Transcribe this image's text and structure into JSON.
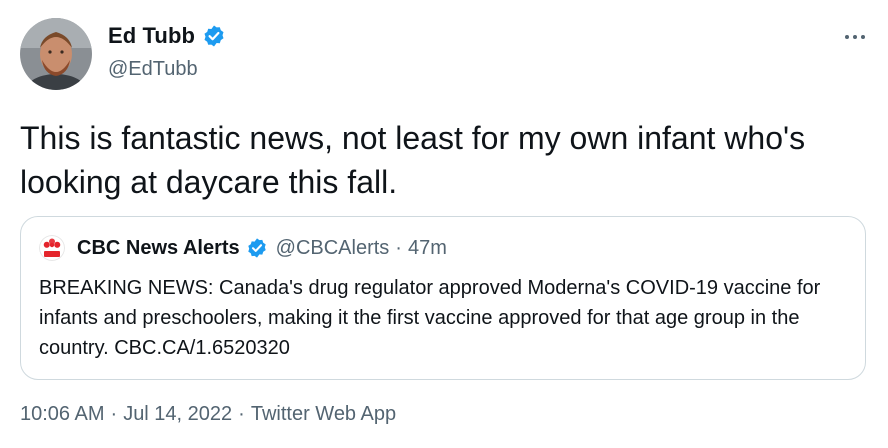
{
  "author": {
    "display_name": "Ed Tubb",
    "handle": "@EdTubb",
    "verified_icon": "verified-badge-icon"
  },
  "tweet": {
    "text": "This is fantastic news, not least for my own infant who's looking at daycare this fall."
  },
  "quoted": {
    "display_name": "CBC News Alerts",
    "handle": "@CBCAlerts",
    "separator": "·",
    "time": "47m",
    "text": "BREAKING NEWS: Canada's drug regulator approved Moderna's COVID-19 vaccine for infants and preschoolers, making it the first vaccine approved for that age group in the country. CBC.CA/1.6520320",
    "avatar_icon": "cbc-logo-icon"
  },
  "meta": {
    "time": "10:06 AM",
    "sep1": "·",
    "date": "Jul 14, 2022",
    "sep2": "·",
    "source": "Twitter Web App"
  },
  "icons": {
    "more": "more-options-icon"
  },
  "colors": {
    "text_primary": "#0f1419",
    "text_secondary": "#536471",
    "verified_blue": "#1d9bf0",
    "border": "#cfd9de",
    "cbc_red": "#e4252c"
  }
}
